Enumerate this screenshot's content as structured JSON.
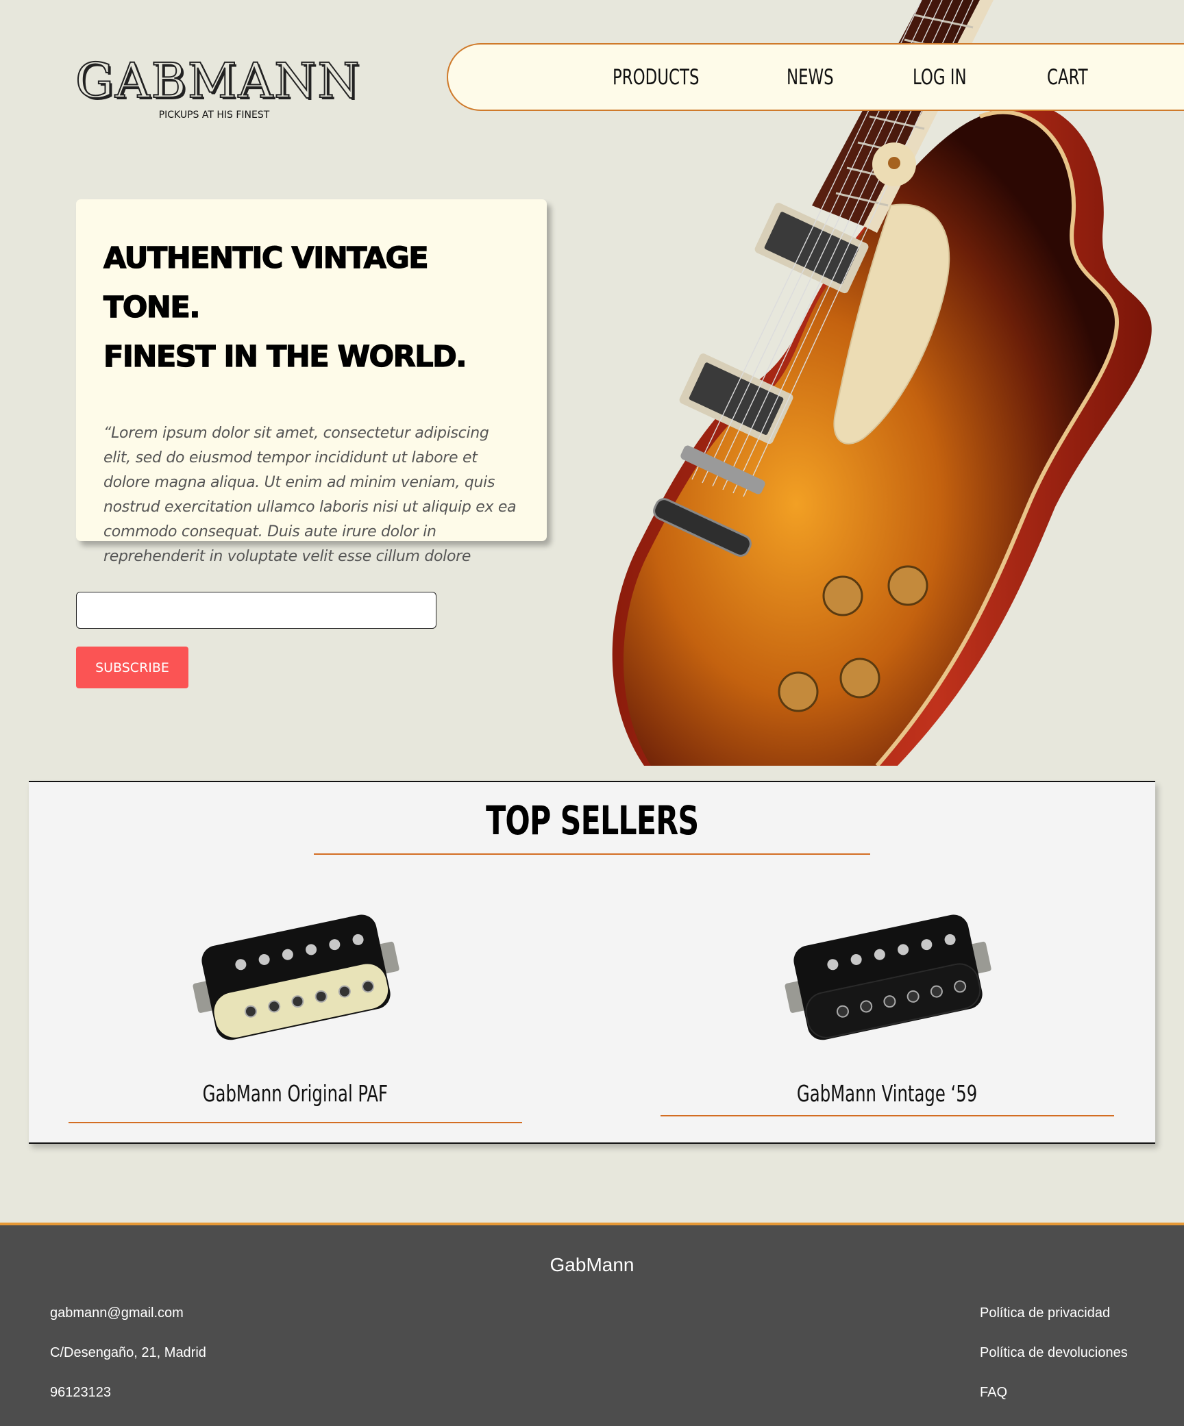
{
  "header": {
    "logo": "GABMANN",
    "tagline": "PICKUPS AT HIS FINEST",
    "nav": [
      "PRODUCTS",
      "NEWS",
      "LOG IN",
      "CART"
    ]
  },
  "hero": {
    "title_line1": "AUTHENTIC VINTAGE TONE.",
    "title_line2": "FINEST IN THE WORLD.",
    "text": "“Lorem ipsum dolor sit amet, consectetur adipiscing elit, sed do eiusmod tempor incididunt ut labore et dolore magna aliqua. Ut enim ad minim veniam, quis nostrud exercitation ullamco laboris nisi ut aliquip ex ea commodo consequat. Duis aute irure dolor in reprehenderit in voluptate velit esse cillum dolore"
  },
  "subscribe": {
    "email_value": "",
    "button_label": "SUBSCRIBE"
  },
  "top_sellers": {
    "title": "TOP SELLERS",
    "products": [
      {
        "name": "GabMann Original PAF"
      },
      {
        "name": "GabMann Vintage ‘59"
      }
    ]
  },
  "footer": {
    "brand": "GabMann",
    "contact": [
      "gabmann@gmail.com",
      "C/Desengaño, 21, Madrid",
      "96123123"
    ],
    "links": [
      "Política de privacidad",
      "Política de devoluciones",
      "FAQ"
    ]
  },
  "colors": {
    "background": "#e7e7dc",
    "accent_orange": "#d36d22",
    "subscribe_red": "#fb5454",
    "card_cream": "#fefbe9",
    "footer_gray": "#4d4d4d"
  }
}
